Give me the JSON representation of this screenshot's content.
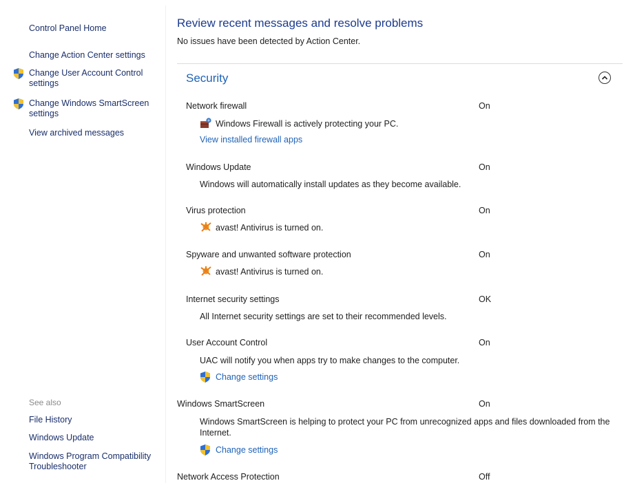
{
  "sidebar": {
    "home": "Control Panel Home",
    "links": [
      "Change Action Center settings",
      "Change User Account Control settings",
      "Change Windows SmartScreen settings",
      "View archived messages"
    ],
    "see_also_title": "See also",
    "see_also": [
      "File History",
      "Windows Update",
      "Windows Program Compatibility Troubleshooter"
    ]
  },
  "main": {
    "title": "Review recent messages and resolve problems",
    "subtitle": "No issues have been detected by Action Center.",
    "section_title": "Security",
    "items": [
      {
        "name": "Network firewall",
        "status": "On",
        "desc": "Windows Firewall is actively protecting your PC.",
        "link": "View installed firewall apps"
      },
      {
        "name": "Windows Update",
        "status": "On",
        "desc": "Windows will automatically install updates as they become available."
      },
      {
        "name": "Virus protection",
        "status": "On",
        "desc": "avast! Antivirus is turned on."
      },
      {
        "name": "Spyware and unwanted software protection",
        "status": "On",
        "desc": "avast! Antivirus is turned on."
      },
      {
        "name": "Internet security settings",
        "status": "OK",
        "desc": "All Internet security settings are set to their recommended levels."
      },
      {
        "name": "User Account Control",
        "status": "On",
        "desc": "UAC will notify you when apps try to make changes to the computer.",
        "link": "Change settings"
      },
      {
        "name": "Windows SmartScreen",
        "status": "On",
        "desc": "Windows SmartScreen is helping to protect your PC from unrecognized apps and files downloaded from the Internet.",
        "link": "Change settings"
      },
      {
        "name": "Network Access Protection",
        "status": "Off"
      }
    ]
  },
  "colors": {
    "link": "#2063b8",
    "title": "#1c3b8f",
    "sidebar_link": "#1a2f6b"
  },
  "icons": [
    "uac-shield-icon",
    "firewall-icon",
    "avast-icon",
    "collapse-chevron-icon"
  ]
}
